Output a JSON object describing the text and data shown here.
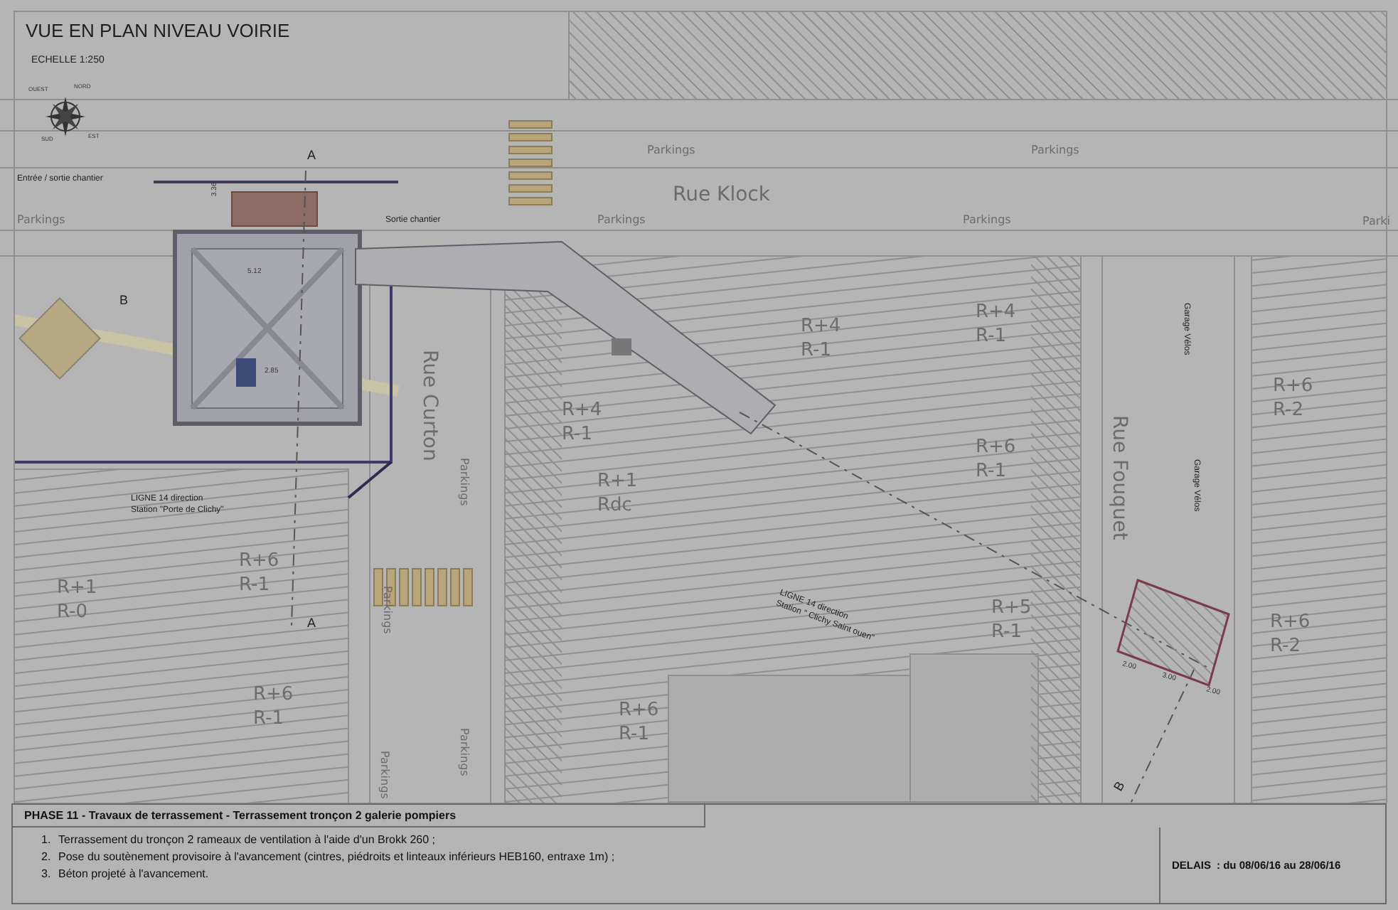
{
  "title": "VUE EN PLAN NIVEAU VOIRIE",
  "scale": "ECHELLE  1:250",
  "compass": [
    "OUEST",
    "NORD",
    "EST",
    "SUD"
  ],
  "plan_labels": [
    {
      "kind": "note",
      "lines": [
        "Entrée / sortie chantier"
      ]
    },
    {
      "kind": "parking",
      "lines": [
        "Parkings"
      ]
    },
    {
      "kind": "note",
      "lines": [
        "Sortie chantier"
      ]
    },
    {
      "kind": "parking",
      "lines": [
        "Parkings"
      ]
    },
    {
      "kind": "parking",
      "lines": [
        "Parkings"
      ]
    },
    {
      "kind": "street",
      "lines": [
        "Rue Klock"
      ]
    },
    {
      "kind": "parking",
      "lines": [
        "Parkings"
      ]
    },
    {
      "kind": "parking",
      "lines": [
        "Parkings"
      ]
    },
    {
      "kind": "parking",
      "lines": [
        "Parki"
      ]
    },
    {
      "kind": "street",
      "lines": [
        "Rue Curton"
      ]
    },
    {
      "kind": "parking",
      "lines": [
        "Parkings"
      ]
    },
    {
      "kind": "parking",
      "lines": [
        "Parkings"
      ]
    },
    {
      "kind": "parking",
      "lines": [
        "Parkings"
      ]
    },
    {
      "kind": "parking",
      "lines": [
        "Parkings"
      ]
    },
    {
      "kind": "street",
      "lines": [
        "Rue Fouquet"
      ]
    },
    {
      "kind": "note",
      "lines": [
        "Garage Vélos"
      ]
    },
    {
      "kind": "note",
      "lines": [
        "Garage Vélos"
      ]
    },
    {
      "kind": "building",
      "lines": [
        "R+4",
        "R-1"
      ]
    },
    {
      "kind": "building",
      "lines": [
        "R+4",
        "R-1"
      ]
    },
    {
      "kind": "building",
      "lines": [
        "R+4",
        "R-1"
      ]
    },
    {
      "kind": "building",
      "lines": [
        "R+6",
        "R-1"
      ]
    },
    {
      "kind": "building",
      "lines": [
        "R+1",
        "Rdc"
      ]
    },
    {
      "kind": "building",
      "lines": [
        "R+1",
        "R-0"
      ]
    },
    {
      "kind": "building",
      "lines": [
        "R+6",
        "R-1"
      ]
    },
    {
      "kind": "building",
      "lines": [
        "R+5",
        "R-1"
      ]
    },
    {
      "kind": "building",
      "lines": [
        "R+6",
        "R-1"
      ]
    },
    {
      "kind": "building",
      "lines": [
        "R+6",
        "R-1"
      ]
    },
    {
      "kind": "building",
      "lines": [
        "R+6",
        "R-2"
      ]
    },
    {
      "kind": "building",
      "lines": [
        "R+6",
        "R-2"
      ]
    },
    {
      "kind": "note",
      "lines": [
        "LIGNE 14 direction",
        "Station \"Porte de Clichy\""
      ]
    },
    {
      "kind": "note",
      "lines": [
        "LIGNE 14 direction",
        "Station \" Clichy Saint ouen\""
      ]
    },
    {
      "kind": "mark",
      "lines": [
        "A"
      ]
    },
    {
      "kind": "mark",
      "lines": [
        "A"
      ]
    },
    {
      "kind": "mark",
      "lines": [
        "B"
      ]
    },
    {
      "kind": "mark",
      "lines": [
        "B"
      ]
    },
    {
      "kind": "dimension",
      "lines": [
        "3.36"
      ]
    },
    {
      "kind": "dimension",
      "lines": [
        "5.12"
      ]
    },
    {
      "kind": "dimension",
      "lines": [
        "2.85"
      ]
    },
    {
      "kind": "dimension",
      "lines": [
        "2.00"
      ]
    },
    {
      "kind": "dimension",
      "lines": [
        "3.00"
      ]
    },
    {
      "kind": "dimension",
      "lines": [
        "2.00"
      ]
    }
  ],
  "phase": {
    "heading": "PHASE 11 - Travaux de terrassement - Terrassement tronçon 2 galerie pompiers",
    "steps": [
      {
        "marker": "1.",
        "text": "Terrassement du tronçon 2 rameaux de ventilation à l'aide d'un Brokk 260 ;"
      },
      {
        "marker": "2.",
        "text": "Pose du soutènement provisoire à l'avancement (cintres, piédroits et linteaux inférieurs HEB160, entraxe 1m) ;"
      },
      {
        "marker": "3.",
        "text": "Béton projeté à l'avancement."
      }
    ],
    "delay_label": "DELAIS",
    "delay_value": ": du 08/06/16 au 28/06/16"
  }
}
